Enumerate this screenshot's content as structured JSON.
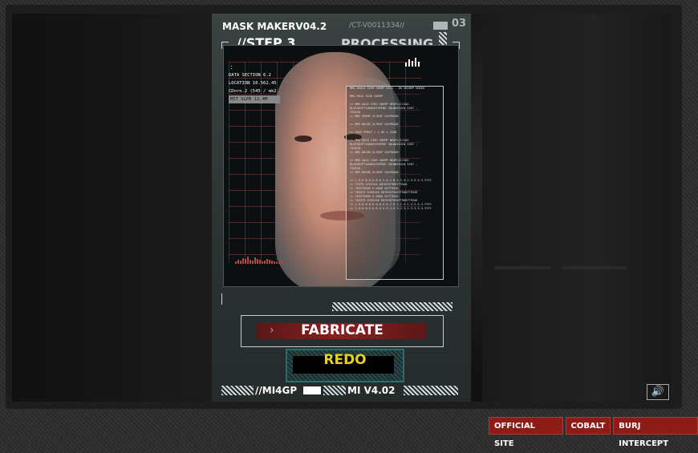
{
  "hud": {
    "app_title": "MASK MAKERV04.2",
    "serial": "/CT-V0011334//",
    "page_number": "03",
    "step": "//STEP 3",
    "status": "PROCESSING"
  },
  "data_section": [
    "DATA SECTION 6.2",
    "LOCATION 10.562.45",
    "CDnrn.2 (545 / mk2",
    "MIT SLPB 12.4M"
  ],
  "readout_lines": [
    "MMG 8GOLD SIDH 58EMP 0334 - 00 565NEP KODEO",
    "",
    "MMG MOLD SIDH 58EMP",
    "",
    ">> MMG GOLD SIDH 58EMP NEOPLIIJIAS",
    "BLAF0E2PT1008SHFUPEBE 3DLN82EVLN 5567 -",
    "734030",
    ">> MMG 58EMP_3L9EOF SAVPKSUB",
    "",
    ">> MMG 8828E_3L9EOF SAVPKSUB",
    "",
    ">> YNIP PMRST = 1.05 V.2348",
    "",
    ">> MMG GOLD SIDH 58EMP NEOPLIIJIAS",
    "BLAF0E2PT1008SHFUPEBE 3DLN82EVLN 5567 -",
    "734030",
    ">> MMG 8828E_3L9EOF SAVPKSUB",
    "",
    ">> MMG GOLD SIDH 58EMP NEOPLIIJIAS",
    "BLAF0E2PT1008SHFUPEBE 3DLN82EVLN 5567 -",
    "734030",
    ">> MMG 8828E_3L9EOF SAVPKSUB",
    "",
    ">> 1.0.6.0.8.6.8.6.5.0.2.0.3.2.3.2.3.3.3.3.YYYY",
    ">> 753T9 0765346 R87655T9687T9346",
    ">> 7653T9000 6.0000 957T9346",
    ">> 7653T9 0765346 R87655T9387T9687T9346",
    ">> 7653T9006 6.0000 957T9346",
    ">> 7653T9 0765346 R87655T9387T9687T9346",
    ">> 1.0.6.0.8.6.8.6.5.0.2.0.3.2.3.2.3.3.3.3.YYYY",
    ">> 1.0.6.0.8.6.8.6.5.0.2.0.3.2.3.2.3.3.3.3.YYYY"
  ],
  "buttons": {
    "fabricate": "FABRICATE",
    "redo": "REDO"
  },
  "footer": {
    "left_code": "//MI4GP",
    "right_code": "MI V4.02"
  },
  "nav": [
    "OFFICIAL SITE",
    "COBALT",
    "BURJ INTERCEPT"
  ],
  "sound_icon": "speaker-icon",
  "colors": {
    "nav_bg": "#8e1b16",
    "fabricate_bar": "#8a2020",
    "redo_text": "#e5d21f",
    "grid_line": "#be3c3c"
  }
}
